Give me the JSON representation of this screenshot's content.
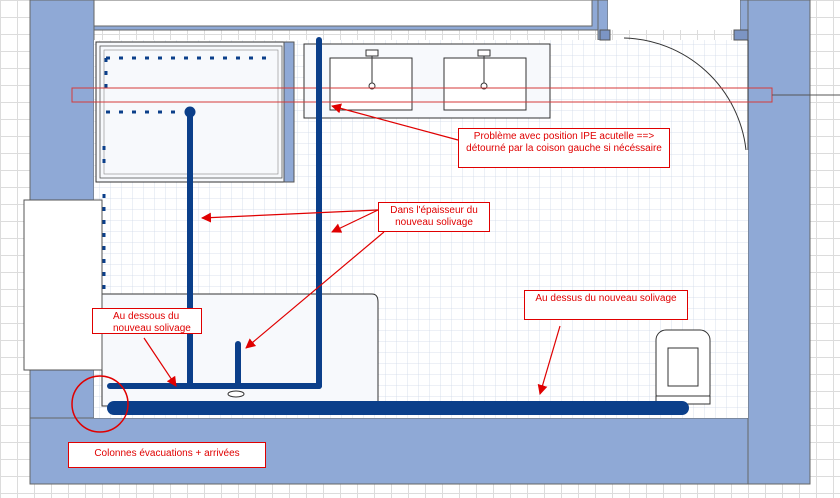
{
  "annotations": {
    "ipe": "Problème avec position IPE acutelle ==> détourné par la coison gauche si nécéssaire",
    "epaisseur": "Dans l'épaisseur du nouveau solivage",
    "dessous": "Au dessous du nouveau solivage",
    "dessus": "Au dessus du nouveau solivage",
    "colonnes": "Colonnes  évacuations + arrivées"
  },
  "colors": {
    "wall": "#8fa9d6",
    "pipe": "#0b3f8a",
    "annotation": "#e00000",
    "grid": "#dcdcdc"
  }
}
